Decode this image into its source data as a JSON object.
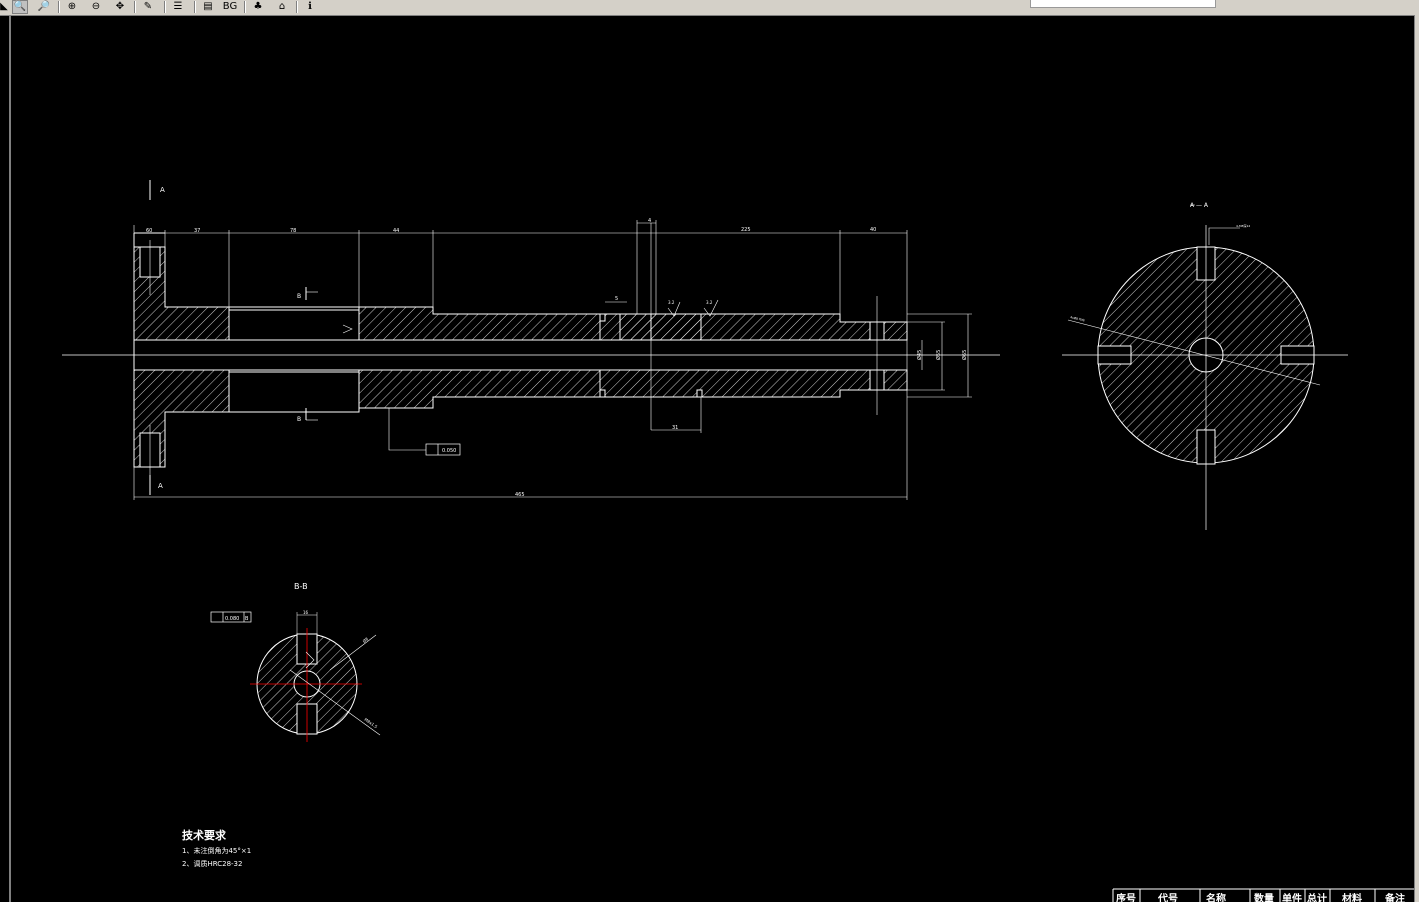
{
  "toolbar": {
    "buttons": [
      {
        "name": "zoom-back-icon",
        "glyph": "◣"
      },
      {
        "name": "zoom-window-icon",
        "glyph": "🔍"
      },
      {
        "name": "zoom-realtime-icon",
        "glyph": "🔎"
      },
      {
        "name": "zoom-in-icon",
        "glyph": "⊕"
      },
      {
        "name": "zoom-out-icon",
        "glyph": "⊖"
      },
      {
        "name": "pan-icon",
        "glyph": "✥"
      },
      {
        "name": "measure-icon",
        "glyph": "✎"
      },
      {
        "name": "layers-icon",
        "glyph": "☰"
      },
      {
        "name": "print-icon",
        "glyph": "▤"
      },
      {
        "name": "background-icon",
        "glyph": "BG"
      },
      {
        "name": "bookmark-icon",
        "glyph": "♣"
      },
      {
        "name": "home-icon",
        "glyph": "⌂"
      },
      {
        "name": "info-icon",
        "glyph": "ℹ"
      }
    ]
  },
  "drawing": {
    "section_a_top": "A",
    "section_a_bottom": "A",
    "section_b_top": "B",
    "section_b_bottom": "B",
    "dims_top": [
      "60",
      "37",
      "78",
      "44",
      "4",
      "225",
      "40",
      "5",
      "3.2",
      "3.2"
    ],
    "dim_total": "465",
    "dim_31": "31",
    "dims_right": [
      "Ø45",
      "Ø55",
      "Ø65"
    ],
    "tolerance_frame": "0.050",
    "view_aa_title": "A — A",
    "view_bb_title": "B-B",
    "bb_tolerance": "0.080",
    "bb_datum": "B",
    "bb_dim_16": "16",
    "bb_dim_r": "Ø8",
    "bb_dim_depth": "M8x1.5",
    "aa_leader": "4xØ8 均布",
    "aa_hole_note": "4-M8深12",
    "tech_title": "技术要求",
    "tech_item1": "1、未注倒角为45°×1",
    "tech_item2": "2、调质HRC28-32",
    "title_block": [
      "序号",
      "代号",
      "名称",
      "数量",
      "单件",
      "总计",
      "材料",
      "备注"
    ]
  },
  "colors": {
    "background": "#000000",
    "lines": "#ffffff",
    "centerline_red": "#ff0000"
  }
}
